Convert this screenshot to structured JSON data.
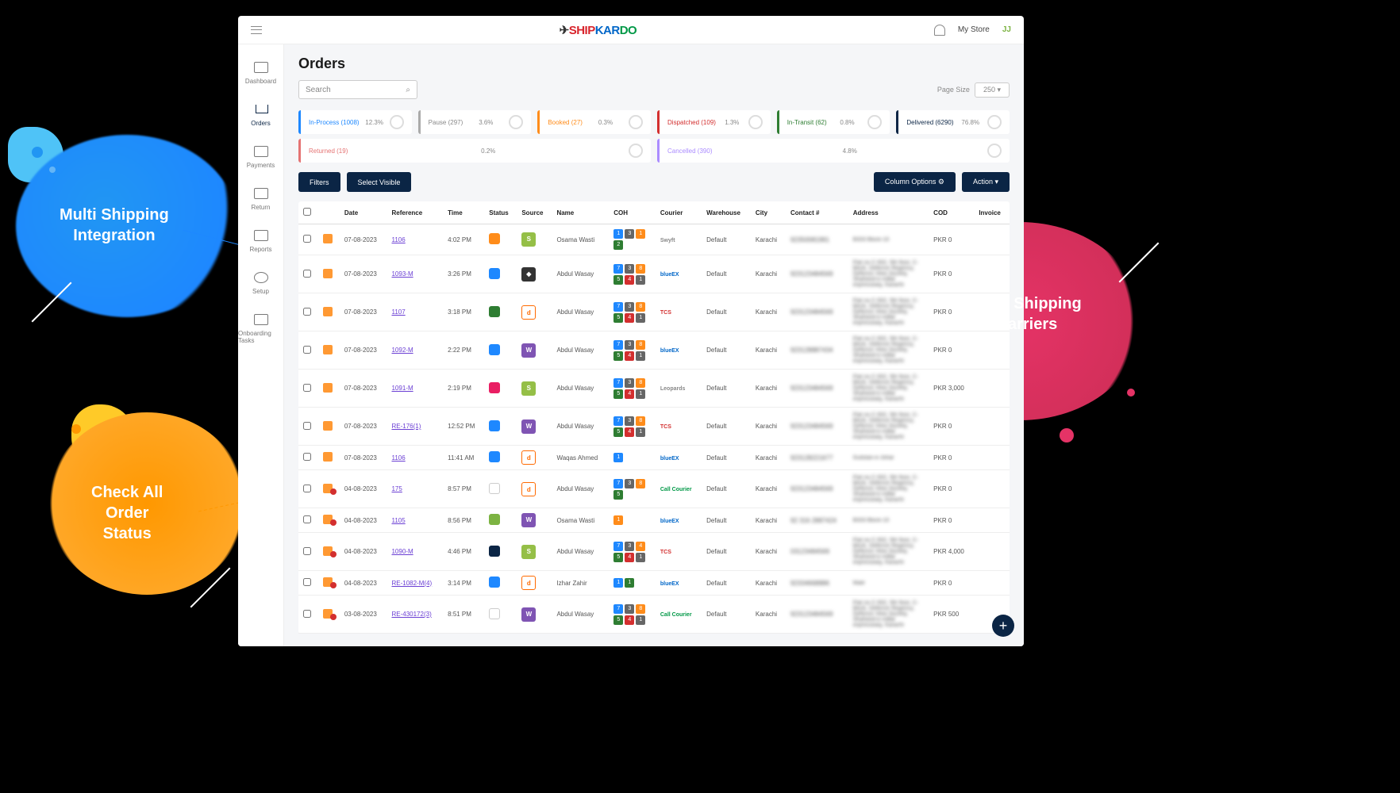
{
  "brand": {
    "name": "SHIPKARDO"
  },
  "topbar": {
    "store": "My Store",
    "avatar": "JJ"
  },
  "sidebar": [
    {
      "label": "Dashboard"
    },
    {
      "label": "Orders"
    },
    {
      "label": "Payments"
    },
    {
      "label": "Return"
    },
    {
      "label": "Reports"
    },
    {
      "label": "Setup"
    },
    {
      "label": "Onboarding Tasks"
    }
  ],
  "page": {
    "title": "Orders",
    "search_placeholder": "Search",
    "page_size_label": "Page Size",
    "page_size": "250"
  },
  "status_cards": [
    {
      "label": "In-Process (1008)",
      "pct": "12.3%",
      "cls": "sc-blue"
    },
    {
      "label": "Pause (297)",
      "pct": "3.6%",
      "cls": "sc-gray"
    },
    {
      "label": "Booked (27)",
      "pct": "0.3%",
      "cls": "sc-orange"
    },
    {
      "label": "Dispatched (109)",
      "pct": "1.3%",
      "cls": "sc-red"
    },
    {
      "label": "In-Transit (62)",
      "pct": "0.8%",
      "cls": "sc-green"
    },
    {
      "label": "Delivered (6290)",
      "pct": "76.8%",
      "cls": "sc-dblue"
    },
    {
      "label": "Returned (19)",
      "pct": "0.2%",
      "cls": "sc-lred"
    },
    {
      "label": "Cancelled (390)",
      "pct": "4.8%",
      "cls": "sc-purple"
    }
  ],
  "buttons": {
    "filters": "Filters",
    "select_visible": "Select Visible",
    "column_options": "Column Options",
    "action": "Action"
  },
  "columns": [
    "",
    "",
    "Date",
    "Reference",
    "Time",
    "Status",
    "Source",
    "Name",
    "COH",
    "Courier",
    "Warehouse",
    "City",
    "Contact #",
    "Address",
    "COD",
    "Invoice"
  ],
  "rows": [
    {
      "dup": false,
      "date": "07-08-2023",
      "ref": "1106",
      "time": "4:02 PM",
      "stat": "si-orange",
      "src": "shopify",
      "srcT": "S",
      "name": "Osama Wasti",
      "coh": [
        [
          "1",
          "c-blue"
        ],
        [
          "3",
          "c-gray"
        ],
        [
          "1",
          "c-orange"
        ],
        [
          "2",
          "c-green"
        ]
      ],
      "courier": "Swyft",
      "cr": "cr-gray",
      "wh": "Default",
      "city": "Karachi",
      "contact": "92350081991",
      "addr": "B333 Block-10",
      "cod": "PKR 0"
    },
    {
      "dup": false,
      "date": "07-08-2023",
      "ref": "1093-M",
      "time": "3:26 PM",
      "stat": "si-blue",
      "src": "own",
      "srcT": "◆",
      "name": "Abdul Wasay",
      "coh": [
        [
          "7",
          "c-blue"
        ],
        [
          "3",
          "c-gray"
        ],
        [
          "8",
          "c-orange"
        ],
        [
          "5",
          "c-green"
        ],
        [
          "4",
          "c-red"
        ],
        [
          "1",
          "c-gray"
        ]
      ],
      "courier": "blueEX",
      "cr": "cr-blue",
      "wh": "Default",
      "city": "Karachi",
      "contact": "923123484569",
      "addr": "Flat no C-502, 5th floor, C-block, Defence Regency, Defence View Society, Shaheed-e-millat expressway, Karachi",
      "cod": "PKR 0"
    },
    {
      "dup": false,
      "date": "07-08-2023",
      "ref": "1107",
      "time": "3:18 PM",
      "stat": "si-green",
      "src": "daraz",
      "srcT": "d",
      "name": "Abdul Wasay",
      "coh": [
        [
          "7",
          "c-blue"
        ],
        [
          "3",
          "c-gray"
        ],
        [
          "8",
          "c-orange"
        ],
        [
          "5",
          "c-green"
        ],
        [
          "4",
          "c-red"
        ],
        [
          "1",
          "c-gray"
        ]
      ],
      "courier": "TCS",
      "cr": "cr-red",
      "wh": "Default",
      "city": "Karachi",
      "contact": "923123484569",
      "addr": "Flat no C-502, 5th floor, C-block, Defence Regency, Defence View Society, Shaheed-e-millat expressway, Karachi",
      "cod": "PKR 0"
    },
    {
      "dup": false,
      "date": "07-08-2023",
      "ref": "1092-M",
      "time": "2:22 PM",
      "stat": "si-blue",
      "src": "woo",
      "srcT": "W",
      "name": "Abdul Wasay",
      "coh": [
        [
          "7",
          "c-blue"
        ],
        [
          "3",
          "c-gray"
        ],
        [
          "8",
          "c-orange"
        ],
        [
          "5",
          "c-green"
        ],
        [
          "4",
          "c-red"
        ],
        [
          "1",
          "c-gray"
        ]
      ],
      "courier": "blueEX",
      "cr": "cr-blue",
      "wh": "Default",
      "city": "Karachi",
      "contact": "923128887434",
      "addr": "Flat no C-502, 5th floor, C-block, Defence Regency, Defence View Society, Shaheed-e-millat expressway, Karachi",
      "cod": "PKR 0"
    },
    {
      "dup": false,
      "date": "07-08-2023",
      "ref": "1091-M",
      "time": "2:19 PM",
      "stat": "si-pink",
      "src": "shopify",
      "srcT": "S",
      "name": "Abdul Wasay",
      "coh": [
        [
          "7",
          "c-blue"
        ],
        [
          "3",
          "c-gray"
        ],
        [
          "8",
          "c-orange"
        ],
        [
          "5",
          "c-green"
        ],
        [
          "4",
          "c-red"
        ],
        [
          "1",
          "c-gray"
        ]
      ],
      "courier": "Leopards",
      "cr": "cr-gray",
      "wh": "Default",
      "city": "Karachi",
      "contact": "923123484569",
      "addr": "Flat no C-502, 5th floor, C-block, Defence Regency, Defence View Society, Shaheed-e-millat expressway, Karachi",
      "cod": "PKR 3,000"
    },
    {
      "dup": false,
      "date": "07-08-2023",
      "ref": "RE-176(1)",
      "time": "12:52 PM",
      "stat": "si-blue",
      "src": "woo",
      "srcT": "W",
      "name": "Abdul Wasay",
      "coh": [
        [
          "7",
          "c-blue"
        ],
        [
          "3",
          "c-gray"
        ],
        [
          "8",
          "c-orange"
        ],
        [
          "5",
          "c-green"
        ],
        [
          "4",
          "c-red"
        ],
        [
          "1",
          "c-gray"
        ]
      ],
      "courier": "TCS",
      "cr": "cr-red",
      "wh": "Default",
      "city": "Karachi",
      "contact": "923123484569",
      "addr": "Flat no C-502, 5th floor, C-block, Defence Regency, Defence View Society, Shaheed-e-millat expressway, Karachi",
      "cod": "PKR 0"
    },
    {
      "dup": false,
      "date": "07-08-2023",
      "ref": "1106",
      "time": "11:41 AM",
      "stat": "si-blue",
      "src": "daraz",
      "srcT": "d",
      "name": "Waqas Ahmed",
      "coh": [
        [
          "1",
          "c-blue"
        ]
      ],
      "courier": "blueEX",
      "cr": "cr-blue",
      "wh": "Default",
      "city": "Karachi",
      "contact": "923128221677",
      "addr": "Gulistan-e-Johar",
      "cod": "PKR 0"
    },
    {
      "dup": true,
      "date": "04-08-2023",
      "ref": "175",
      "time": "8:57 PM",
      "stat": "si-white",
      "src": "daraz",
      "srcT": "d",
      "name": "Abdul Wasay",
      "coh": [
        [
          "7",
          "c-blue"
        ],
        [
          "3",
          "c-gray"
        ],
        [
          "8",
          "c-orange"
        ],
        [
          "5",
          "c-green"
        ]
      ],
      "courier": "Call Courier",
      "cr": "cr-green",
      "wh": "Default",
      "city": "Karachi",
      "contact": "923123484569",
      "addr": "Flat no C-502, 5th floor, C-block, Defence Regency, Defence View Society, Shaheed-e-millat expressway, Karachi",
      "cod": "PKR 0"
    },
    {
      "dup": true,
      "date": "04-08-2023",
      "ref": "1105",
      "time": "8:56 PM",
      "stat": "si-lgreen",
      "src": "woo",
      "srcT": "W",
      "name": "Osama Wasti",
      "coh": [
        [
          "1",
          "c-orange"
        ]
      ],
      "courier": "blueEX",
      "cr": "cr-blue",
      "wh": "Default",
      "city": "Karachi",
      "contact": "92 316 2887424",
      "addr": "B333 Block-10",
      "cod": "PKR 0"
    },
    {
      "dup": true,
      "date": "04-08-2023",
      "ref": "1090-M",
      "time": "4:46 PM",
      "stat": "si-dblue",
      "src": "shopify",
      "srcT": "S",
      "name": "Abdul Wasay",
      "coh": [
        [
          "7",
          "c-blue"
        ],
        [
          "3",
          "c-gray"
        ],
        [
          "4",
          "c-orange"
        ],
        [
          "5",
          "c-green"
        ],
        [
          "4",
          "c-red"
        ],
        [
          "1",
          "c-gray"
        ]
      ],
      "courier": "TCS",
      "cr": "cr-red",
      "wh": "Default",
      "city": "Karachi",
      "contact": "03123484569",
      "addr": "Flat no C-502, 5th floor, C-block, Defence Regency, Defence View Society, Shaheed-e-millat expressway, Karachi",
      "cod": "PKR 4,000"
    },
    {
      "dup": true,
      "date": "04-08-2023",
      "ref": "RE-1082-M(4)",
      "time": "3:14 PM",
      "stat": "si-blue",
      "src": "daraz",
      "srcT": "d",
      "name": "Izhar Zahir",
      "coh": [
        [
          "1",
          "c-blue"
        ],
        [
          "1",
          "c-green"
        ]
      ],
      "courier": "blueEX",
      "cr": "cr-blue",
      "wh": "Default",
      "city": "Karachi",
      "contact": "92334668886",
      "addr": "Malir",
      "cod": "PKR 0"
    },
    {
      "dup": true,
      "date": "03-08-2023",
      "ref": "RE-430172(3)",
      "time": "8:51 PM",
      "stat": "si-white",
      "src": "woo",
      "srcT": "W",
      "name": "Abdul Wasay",
      "coh": [
        [
          "7",
          "c-blue"
        ],
        [
          "3",
          "c-gray"
        ],
        [
          "8",
          "c-orange"
        ],
        [
          "5",
          "c-green"
        ],
        [
          "4",
          "c-red"
        ],
        [
          "1",
          "c-gray"
        ]
      ],
      "courier": "Call Courier",
      "cr": "cr-green",
      "wh": "Default",
      "city": "Karachi",
      "contact": "923123484569",
      "addr": "Flat no C-502, 5th floor, C-block, Defence Regency, Defence View Society, Shaheed-e-millat expressway, Karachi",
      "cod": "PKR 500"
    }
  ],
  "callouts": {
    "integration": "Multi Shipping\nIntegration",
    "carriers": "Multi Shipping\nCarriers",
    "status": "Check All\nOrder\nStatus"
  }
}
